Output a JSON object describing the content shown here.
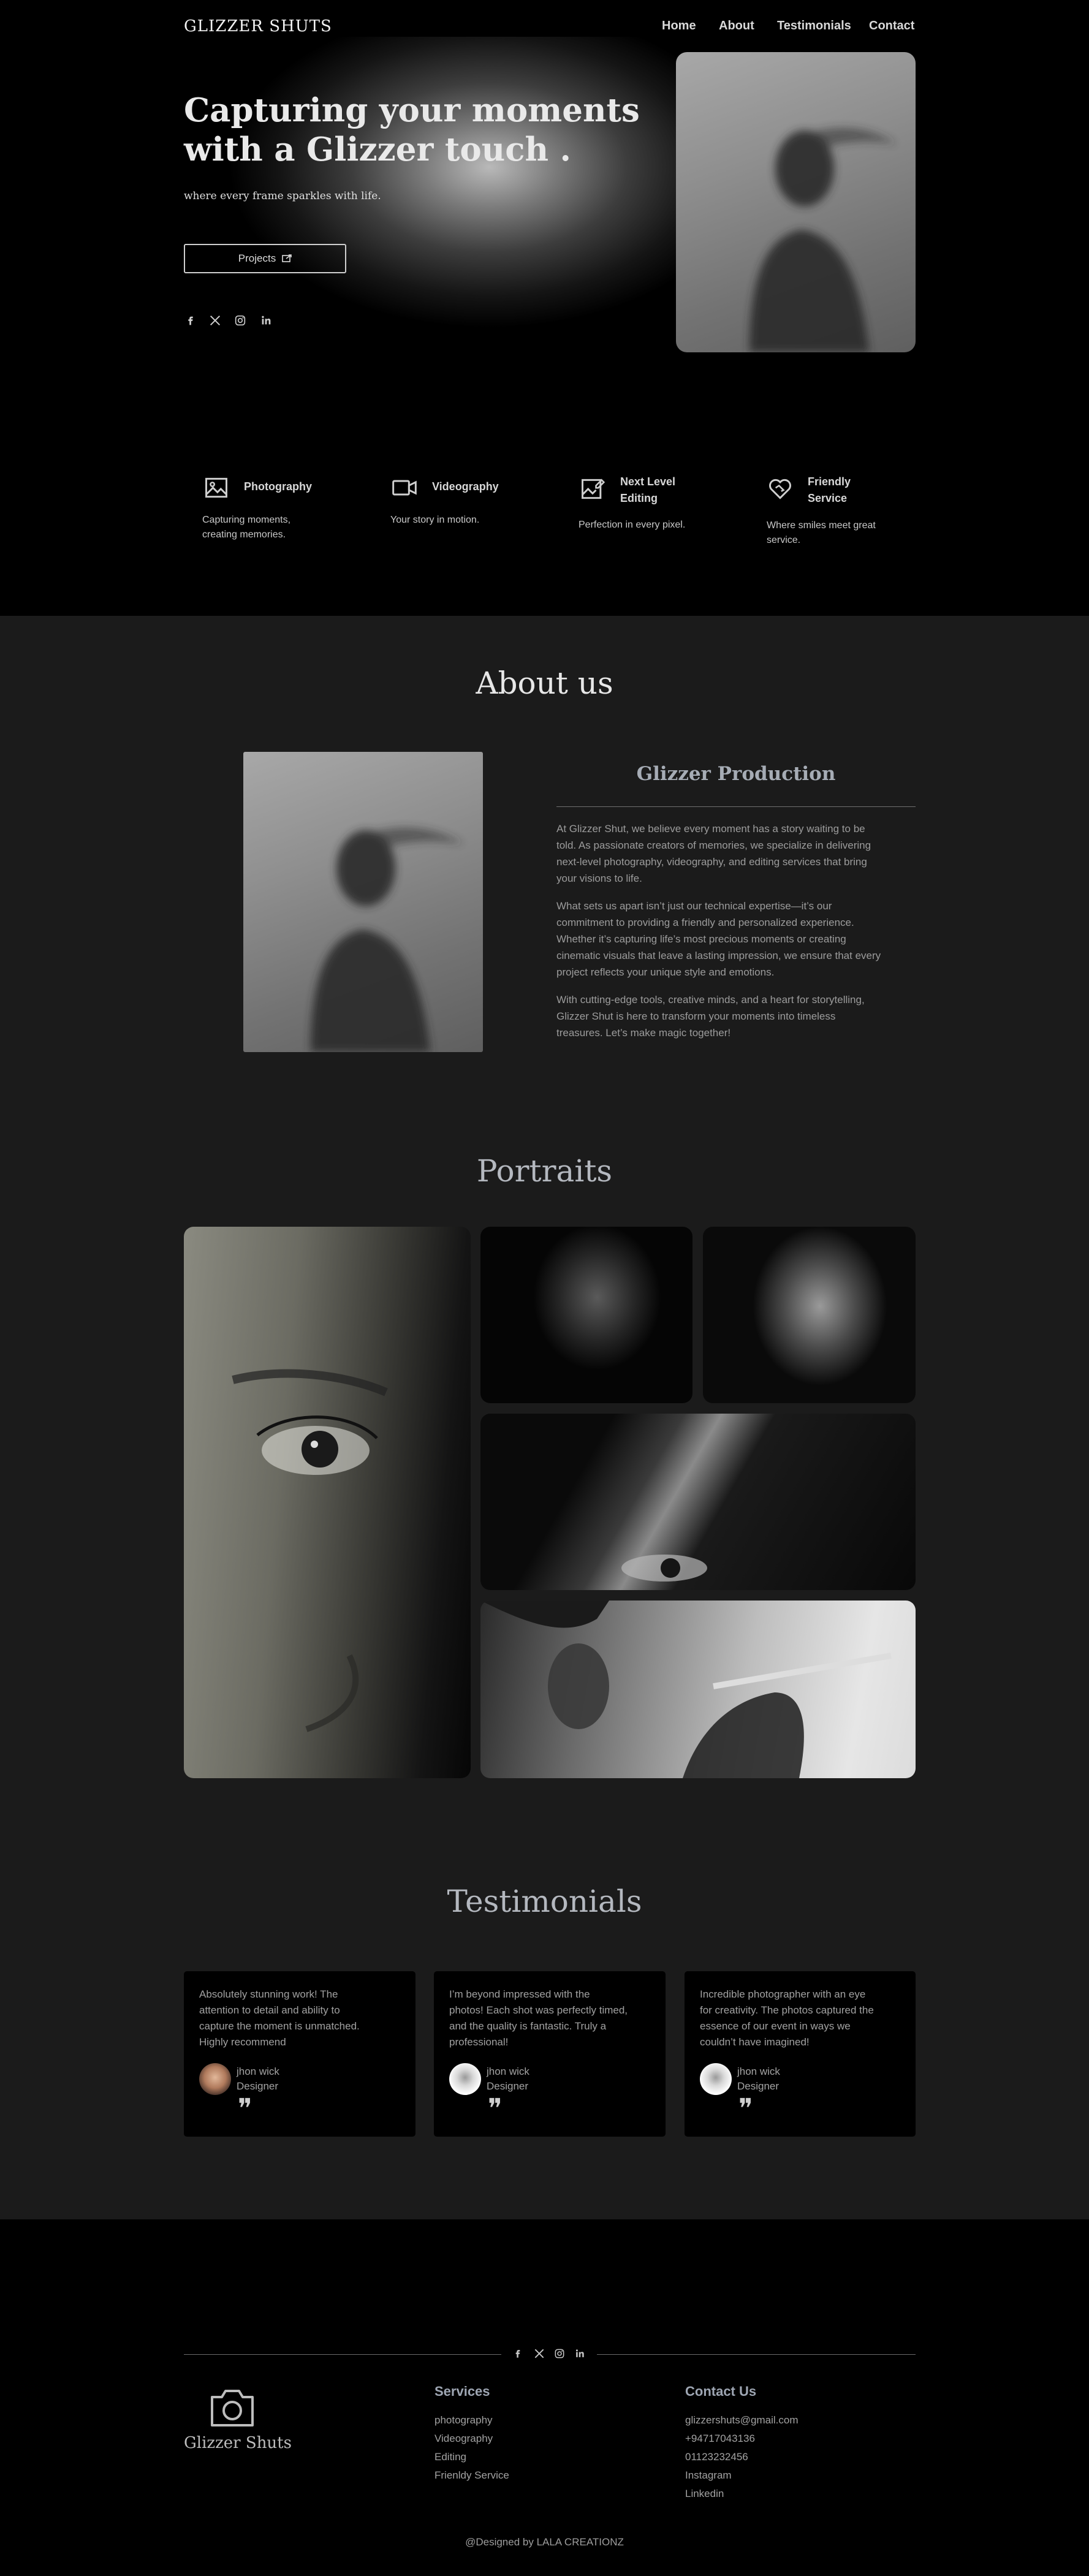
{
  "brand": "GLIZZER SHUTS",
  "nav": {
    "home": "Home",
    "about": "About",
    "testimonials": "Testimonials",
    "contact": "Contact"
  },
  "hero": {
    "title_line1": "Capturing your moments",
    "title_line2": "with a Glizzer touch .",
    "subtitle": "where every frame sparkles with life.",
    "button_label": "Projects",
    "socials": [
      "facebook-icon",
      "x-twitter-icon",
      "instagram-icon",
      "linkedin-icon"
    ]
  },
  "features": [
    {
      "icon": "image-icon",
      "title": "Photography",
      "desc_line1": "Capturing moments,",
      "desc_line2": "creating memories."
    },
    {
      "icon": "video-icon",
      "title": "Videography",
      "desc_line1": "Your story in motion.",
      "desc_line2": ""
    },
    {
      "icon": "edit-image-icon",
      "title_line1": "Next Level",
      "title_line2": "Editing",
      "desc_line1": "Perfection in every pixel.",
      "desc_line2": ""
    },
    {
      "icon": "heart-handshake-icon",
      "title_line1": "Friendly",
      "title_line2": "Service",
      "desc_line1": "Where smiles meet great",
      "desc_line2": "service."
    }
  ],
  "about": {
    "heading": "About us",
    "subheading": "Glizzer Production",
    "p1": [
      "At Glizzer Shut, we believe every moment has a story waiting to be",
      "told. As passionate creators of memories, we specialize in delivering",
      "next-level photography, videography, and editing services that bring",
      "your visions to life."
    ],
    "p2": [
      "What sets us apart isn’t just our technical expertise—it’s our",
      "commitment to providing a friendly and personalized experience.",
      "Whether it’s capturing life’s most precious moments or creating",
      "cinematic visuals that leave a lasting impression, we ensure that every",
      "project reflects your unique style and emotions."
    ],
    "p3": [
      "With cutting-edge tools, creative minds, and a heart for storytelling,",
      "Glizzer Shut is here to transform your moments into timeless",
      "treasures. Let’s make magic together!"
    ]
  },
  "portraits": {
    "heading": "Portraits"
  },
  "testimonials": {
    "heading": "Testimonials",
    "cards": [
      {
        "text": [
          "Absolutely stunning work! The",
          "attention to detail and ability to",
          "capture the moment is unmatched.",
          "Highly recommend"
        ],
        "name": "jhon wick",
        "role": "Designer"
      },
      {
        "text": [
          "I’m beyond impressed with the",
          "photos! Each shot was perfectly timed,",
          "and the quality is fantastic. Truly a",
          "professional!"
        ],
        "name": "jhon wick",
        "role": "Designer"
      },
      {
        "text": [
          "Incredible photographer with an eye",
          "for creativity. The photos captured the",
          "essence of our event in ways we",
          "couldn’t have imagined!"
        ],
        "name": "jhon wick",
        "role": "Designer"
      }
    ],
    "quote_mark": "❞"
  },
  "footer": {
    "brand": "Glizzer Shuts",
    "services_heading": "Services",
    "services": [
      "photography",
      "Videography",
      "Editing",
      "Frienldy Service"
    ],
    "contact_heading": "Contact Us",
    "contact": [
      "glizzershuts@gmail.com",
      "+94717043136",
      "01123232456",
      "Instagram",
      "Linkedin"
    ],
    "credit": "@Designed by LALA CREATIONZ"
  },
  "colors": {
    "hero_bg": "#000000",
    "page_bg": "#1b1b1b",
    "accent_heading": "#a6acb5"
  }
}
